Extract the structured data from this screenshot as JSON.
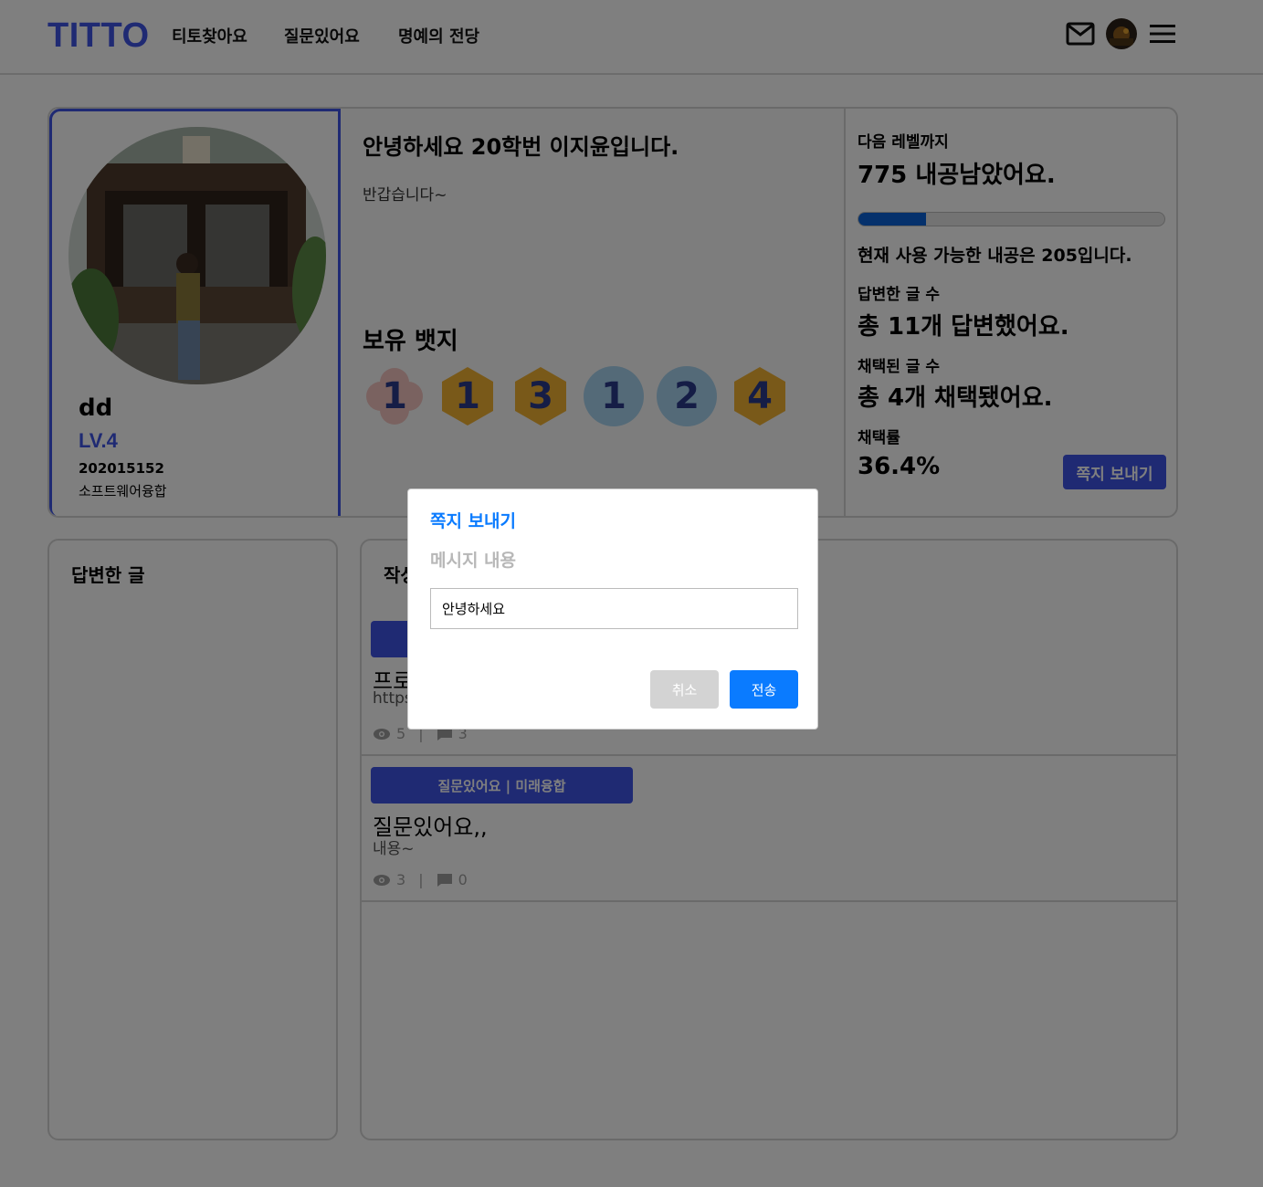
{
  "header": {
    "logo": "TITTO",
    "nav": [
      "티토찾아요",
      "질문있어요",
      "명예의 전당"
    ],
    "icons": [
      "mail-icon",
      "avatar",
      "menu-icon"
    ]
  },
  "profile": {
    "name": "dd",
    "level": "LV.4",
    "student_id": "202015152",
    "major": "소프트웨어융합",
    "intro_title": "안녕하세요 20학번 이지윤입니다.",
    "intro_text": "반갑습니다~",
    "badges_title": "보유 뱃지",
    "badges": [
      {
        "label": "1",
        "shape": "flower",
        "color": "#f4c4c0",
        "text_color": "#2b3a8c"
      },
      {
        "label": "1",
        "shape": "hexagon",
        "color": "#f2b233",
        "text_color": "#2b3a8c"
      },
      {
        "label": "3",
        "shape": "hexagon",
        "color": "#f2b233",
        "text_color": "#2b3a8c"
      },
      {
        "label": "1",
        "shape": "circle",
        "color": "#a9d4f0",
        "text_color": "#2b3a8c"
      },
      {
        "label": "2",
        "shape": "circle",
        "color": "#a9d4f0",
        "text_color": "#2b3a8c"
      },
      {
        "label": "4",
        "shape": "hexagon",
        "color": "#f2b233",
        "text_color": "#2b3a8c"
      }
    ],
    "next_level_label": "다음 레벨까지",
    "next_level_value": "775 내공남았어요.",
    "progress_fraction": 0.22,
    "available_points": "현재 사용 가능한 내공은 205입니다.",
    "answered_label": "답변한 글 수",
    "answered_value": "총 11개 답변했어요.",
    "accepted_label": "채택된 글 수",
    "accepted_value": "총 4개 채택됐어요.",
    "rate_label": "채택률",
    "rate_value": "36.4%",
    "send_message_button": "쪽지 보내기"
  },
  "answers_panel": {
    "title": "답변한 글"
  },
  "posts_panel": {
    "title_partial": "작성",
    "posts": [
      {
        "tag": "",
        "title": "프로",
        "body": "https",
        "views": "5",
        "comments": "3"
      },
      {
        "tag": "질문있어요 | 미래융합",
        "title": "질문있어요,,",
        "body": "내용~",
        "views": "3",
        "comments": "0"
      }
    ]
  },
  "modal": {
    "title": "쪽지 보내기",
    "label": "메시지 내용",
    "input_value": "안녕하세요",
    "cancel": "취소",
    "submit": "전송"
  },
  "colors": {
    "brand": "#3f55e6",
    "modal_accent": "#0a7bff",
    "progress": "#0a63d9"
  }
}
